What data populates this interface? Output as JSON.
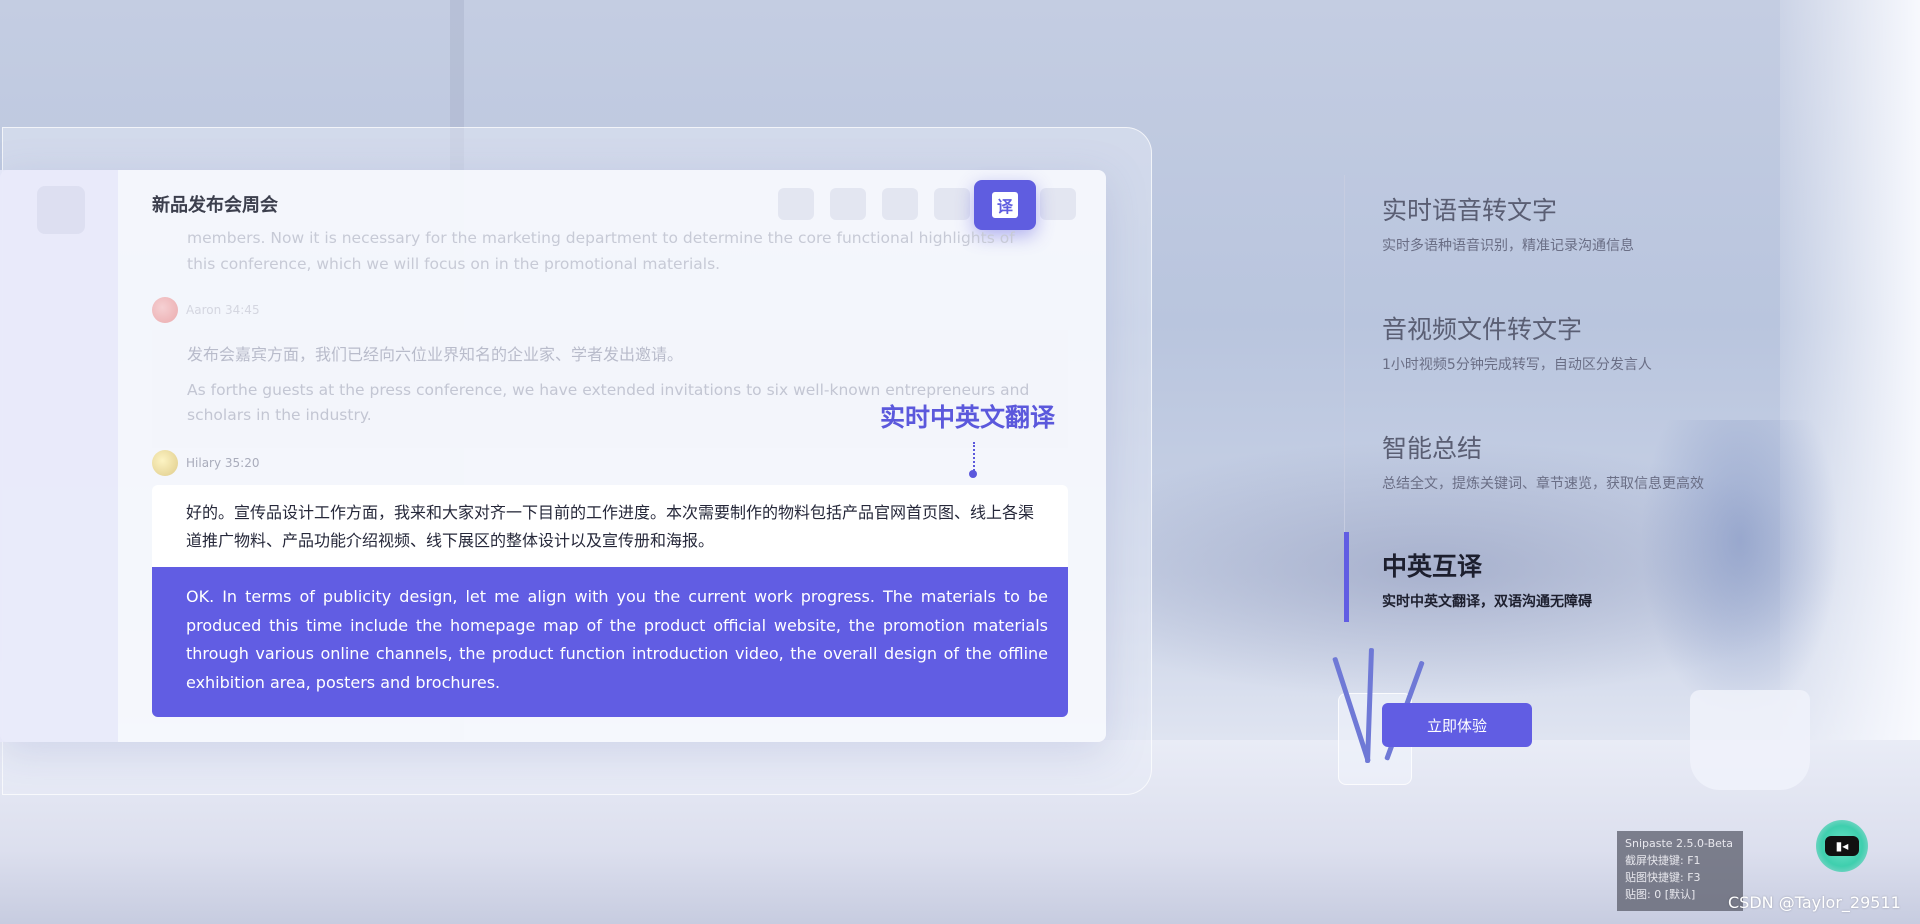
{
  "app": {
    "title": "新品发布会周会",
    "translate_icon_label": "译",
    "faded_english_top": "members. Now it is necessary for the marketing department to determine the core functional highlights of this conference, which we will focus on in the promotional materials.",
    "speaker_1": {
      "name": "Aaron",
      "time": "34:45"
    },
    "speaker_1_line": "Aaron 34:45",
    "message_1_cn": "发布会嘉宾方面，我们已经向六位业界知名的企业家、学者发出邀请。",
    "message_1_en": "As forthe guests at the press conference, we have extended invitations to six well-known entrepreneurs and scholars in the industry.",
    "speaker_2_line": "Hilary 35:20",
    "message_2_cn": "好的。宣传品设计工作方面，我来和大家对齐一下目前的工作进度。本次需要制作的物料包括产品官网首页图、线上各渠道推广物料、产品功能介绍视频、线下展区的整体设计以及宣传册和海报。",
    "message_2_en": "OK. In terms of publicity design, let me align with you the current work progress. The materials to be produced this time include the homepage map of the product official website, the promotion materials through various online channels, the product function introduction video, the overall design of the offline exhibition area, posters and brochures."
  },
  "callout": {
    "label": "实时中英文翻译"
  },
  "features": [
    {
      "title": "实时语音转文字",
      "desc": "实时多语种语音识别，精准记录沟通信息",
      "active": false
    },
    {
      "title": "音视频文件转文字",
      "desc": "1小时视频5分钟完成转写，自动区分发言人",
      "active": false
    },
    {
      "title": "智能总结",
      "desc": "总结全文，提炼关键词、章节速览，获取信息更高效",
      "active": false
    },
    {
      "title": "中英互译",
      "desc": "实时中英文翻译，双语沟通无障碍",
      "active": true
    }
  ],
  "cta": {
    "label": "立即体验"
  },
  "snipaste": {
    "line1": "Snipaste 2.5.0-Beta",
    "line2": "截屏快捷键: F1",
    "line3": "贴图快捷键: F3",
    "line4": "贴图: 0 [默认]"
  },
  "watermark": "CSDN @Taylor_29511",
  "colors": {
    "accent": "#615de3",
    "callout": "#5b58dc"
  }
}
